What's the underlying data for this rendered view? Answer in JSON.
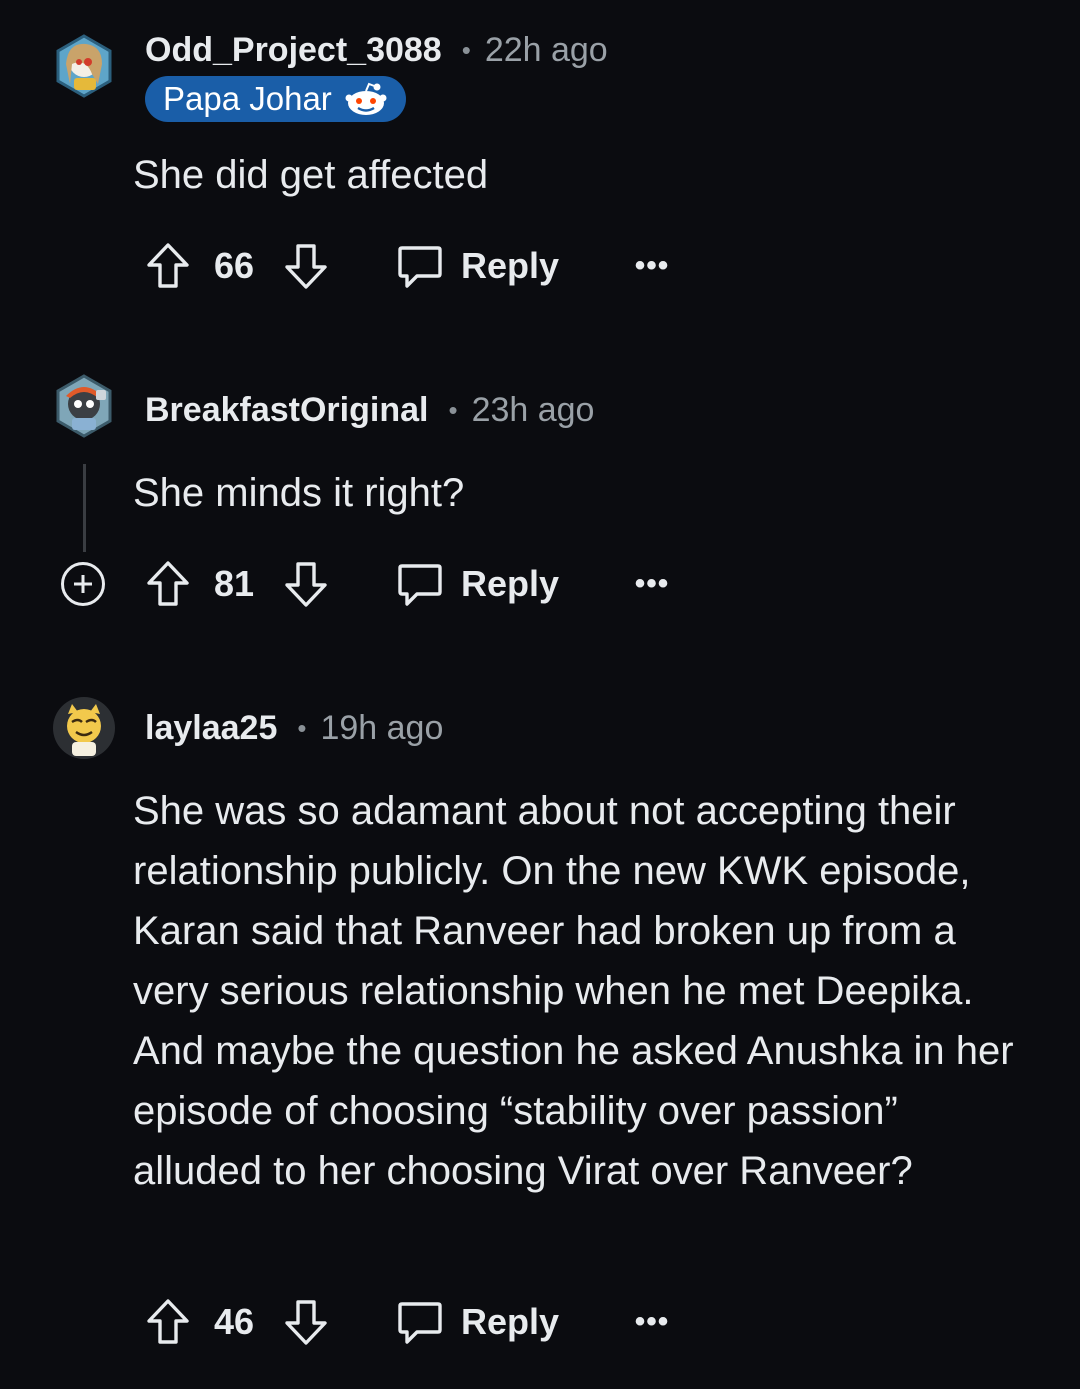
{
  "comments": [
    {
      "username": "Odd_Project_3088",
      "time": "22h ago",
      "flair": "Papa Johar",
      "body": "She did get affected",
      "votes": "66",
      "reply_label": "Reply",
      "more_label": "•••"
    },
    {
      "username": "BreakfastOriginal",
      "time": "23h ago",
      "body": "She minds it right?",
      "votes": "81",
      "reply_label": "Reply",
      "more_label": "•••"
    },
    {
      "username": "laylaa25",
      "time": "19h ago",
      "body": "She was so adamant about not accepting their relationship publicly. On the new KWK episode, Karan said that Ranveer had broken up from a very serious relationship when he met Deepika. And maybe the question he asked Anushka in her episode of choosing “stability over passion” alluded to her choosing Virat over Ranveer?",
      "votes": "46",
      "reply_label": "Reply",
      "more_label": "•••"
    }
  ],
  "colors": {
    "background": "#0b0c10",
    "text": "#e8ebee",
    "muted": "#9aa1a7",
    "flair_bg": "#1a5ea8"
  },
  "icons": {
    "upvote": "arrow-up-outline-icon",
    "downvote": "arrow-down-outline-icon",
    "reply": "speech-bubble-icon",
    "more": "ellipsis-icon",
    "expand": "plus-circle-icon",
    "flair_emoji": "reddit-snoo-icon"
  }
}
